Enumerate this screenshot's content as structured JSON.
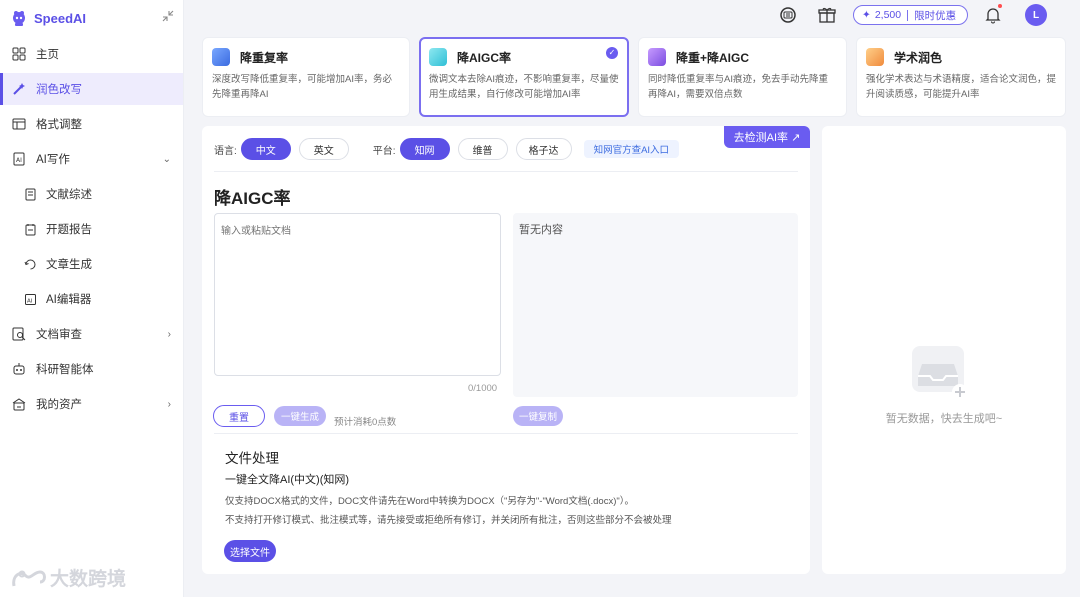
{
  "brand": {
    "name": "SpeedAI"
  },
  "sidebar": {
    "items": [
      {
        "label": "主页",
        "icon": "grid-icon"
      },
      {
        "label": "润色改写",
        "icon": "magic-wand-icon",
        "active": true
      },
      {
        "label": "格式调整",
        "icon": "format-icon"
      },
      {
        "label": "AI写作",
        "icon": "ai-write-icon",
        "expanded": true
      },
      {
        "label": "文献综述",
        "icon": "document-icon",
        "sub": true
      },
      {
        "label": "开题报告",
        "icon": "report-icon",
        "sub": true
      },
      {
        "label": "文章生成",
        "icon": "refresh-doc-icon",
        "sub": true
      },
      {
        "label": "AI编辑器",
        "icon": "ai-editor-icon",
        "sub": true
      },
      {
        "label": "文档审查",
        "icon": "doc-search-icon"
      },
      {
        "label": "科研智能体",
        "icon": "robot-icon"
      },
      {
        "label": "我的资产",
        "icon": "wallet-icon"
      }
    ]
  },
  "topbar": {
    "points": "2,500",
    "promo": "限时优惠",
    "avatar_letter": "L"
  },
  "cards": [
    {
      "title": "降重复率",
      "desc": "深度改写降低重复率，可能增加AI率，务必先降重再降AI"
    },
    {
      "title": "降AIGC率",
      "desc": "微调文本去除AI痕迹，不影响重复率，尽量使用生成结果，自行修改可能增加AI率",
      "selected": true
    },
    {
      "title": "降重+降AIGC",
      "desc": "同时降低重复率与AI痕迹，免去手动先降重再降AI，需要双倍点数"
    },
    {
      "title": "学术润色",
      "desc": "强化学术表达与术语精度，适合论文润色，提升阅读质感，可能提升AI率"
    }
  ],
  "main": {
    "lang_label": "语言:",
    "lang_options": [
      "中文",
      "英文"
    ],
    "platform_label": "平台:",
    "platform_options": [
      "知网",
      "维普",
      "格子达"
    ],
    "official_link": "知网官方查AI入口",
    "detect_btn": "去检测AI率 ↗",
    "title": "降AIGC率",
    "input_placeholder": "输入或粘贴文档",
    "counter": "0/1000",
    "output_empty": "暂无内容",
    "reset_btn": "重置",
    "generate_btn": "一键生成",
    "cost_text": "预计消耗0点数",
    "copy_btn": "一键复制",
    "file_title": "文件处理",
    "file_sub": "一键全文降AI(中文)(知网)",
    "file_note1": "仅支持DOCX格式的文件，DOC文件请先在Word中转换为DOCX（\"另存为\"-\"Word文档(.docx)\"）。",
    "file_note2": "不支持打开修订模式、批注模式等，请先接受或拒绝所有修订，并关闭所有批注，否则这些部分不会被处理",
    "file_btn": "选择文件"
  },
  "right": {
    "empty_text": "暂无数据，快去生成吧~"
  },
  "watermark": "大数跨境",
  "colors": {
    "accent": "#5b50e6",
    "accent_light": "#b9b3f6",
    "bg": "#f3f4f8"
  }
}
